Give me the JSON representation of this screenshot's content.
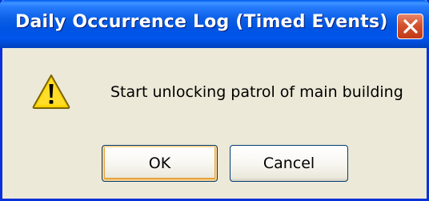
{
  "dialog": {
    "title": "Daily Occurrence Log (Timed Events)",
    "icon": "warning-icon",
    "message": "Start unlocking patrol of main building",
    "buttons": {
      "ok_label": "OK",
      "cancel_label": "Cancel"
    }
  },
  "colors": {
    "titlebar": "#0054e3",
    "close_button": "#d4512e",
    "body": "#ece9d8",
    "warning_yellow": "#ffd400"
  }
}
